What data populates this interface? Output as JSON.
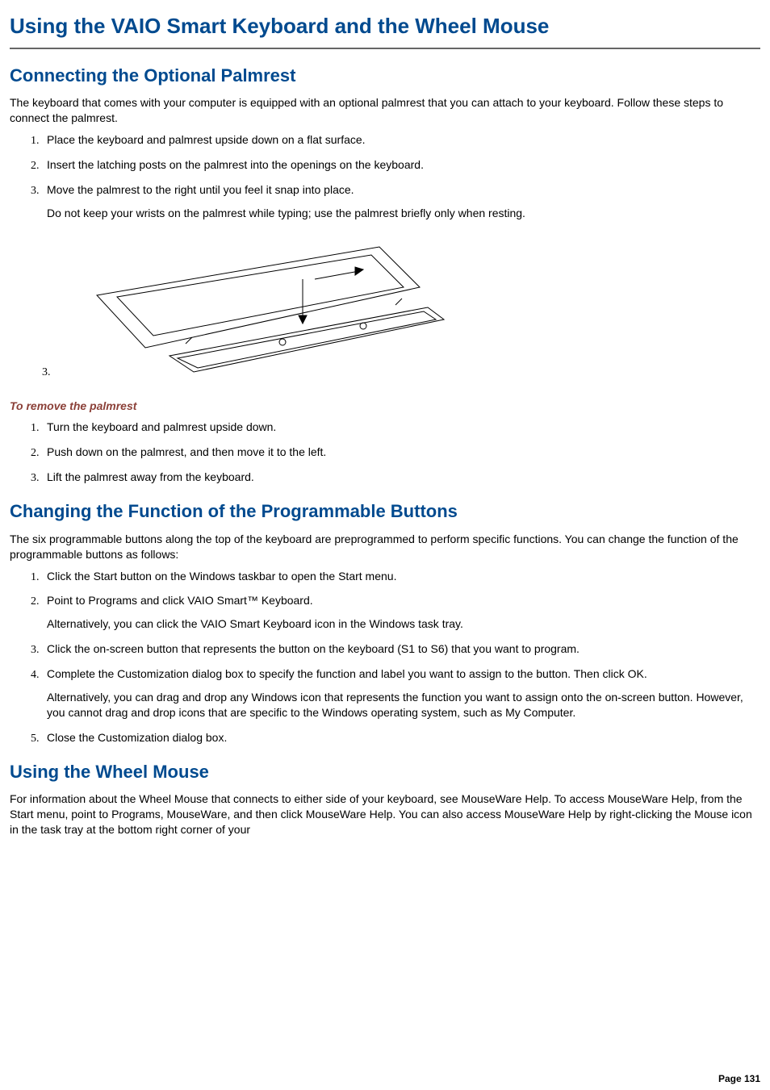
{
  "title": "Using the VAIO Smart Keyboard and the Wheel Mouse",
  "sections": {
    "connect": {
      "heading": "Connecting the Optional Palmrest",
      "intro": "The keyboard that comes with your computer is equipped with an optional palmrest that you can attach to your keyboard. Follow these steps to connect the palmrest.",
      "steps": [
        "Place the keyboard and palmrest upside down on a flat surface.",
        "Insert the latching posts on the palmrest into the openings on the keyboard.",
        "Move the palmrest to the right until you feel it snap into place."
      ],
      "note": "Do not keep your wrists on the palmrest while typing; use the palmrest briefly only when resting.",
      "image_marker": "3."
    },
    "remove": {
      "heading": "To remove the palmrest",
      "steps": [
        "Turn the keyboard and palmrest upside down.",
        "Push down on the palmrest, and then move it to the left.",
        "Lift the palmrest away from the keyboard."
      ]
    },
    "programmable": {
      "heading": "Changing the Function of the Programmable Buttons",
      "intro": "The six programmable buttons along the top of the keyboard are preprogrammed to perform specific functions. You can change the function of the programmable buttons as follows:",
      "steps": [
        "Click the Start button on the Windows taskbar to open the Start menu.",
        "Point to Programs and click VAIO Smart™ Keyboard.",
        "Click the on-screen button that represents the button on the keyboard (S1 to S6) that you want to program.",
        "Complete the Customization dialog box to specify the function and label you want to assign to the button. Then click OK.",
        "Close the Customization dialog box."
      ],
      "note2": "Alternatively, you can click the VAIO Smart Keyboard icon in the Windows task tray.",
      "note4": "Alternatively, you can drag and drop any Windows icon that represents the function you want to assign onto the on-screen button. However, you cannot drag and drop icons that are specific to the Windows operating system, such as My Computer."
    },
    "wheel": {
      "heading": "Using the Wheel Mouse",
      "intro": "For information about the Wheel Mouse that connects to either side of your keyboard, see MouseWare Help. To access MouseWare Help, from the Start menu, point to Programs, MouseWare, and then click MouseWare Help. You can also access MouseWare Help by right-clicking the Mouse icon in the task tray at the bottom right corner of your"
    }
  },
  "page_label": "Page 131"
}
